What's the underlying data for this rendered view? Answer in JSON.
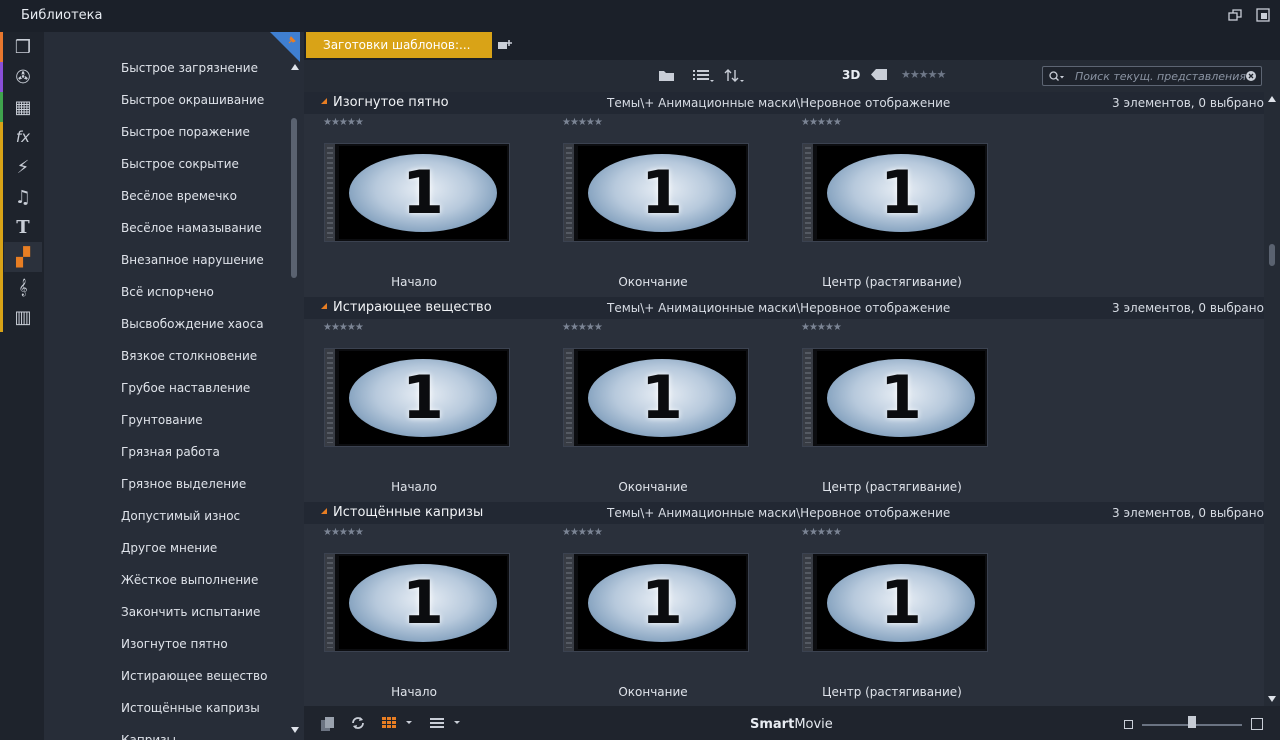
{
  "app": {
    "title": "Библиотека"
  },
  "sidebar_icons": [
    {
      "name": "project-icon",
      "color": "#e8772e",
      "glyph": "❒"
    },
    {
      "name": "video-reel-icon",
      "color": "#8a4fd8",
      "glyph": "✇"
    },
    {
      "name": "photos-icon",
      "color": "#3fa34d",
      "glyph": "▦"
    },
    {
      "name": "fx-icon",
      "color": "#d9a317",
      "glyph": "fx"
    },
    {
      "name": "transition-icon",
      "color": "#d9a317",
      "glyph": "⚡"
    },
    {
      "name": "music-icon",
      "color": "#d9a317",
      "glyph": "♫"
    },
    {
      "name": "title-icon",
      "color": "#d9a317",
      "glyph": "T"
    },
    {
      "name": "montage-icon",
      "color": "#d9a317",
      "glyph": "▞"
    },
    {
      "name": "sound-effect-icon",
      "color": "#d9a317",
      "glyph": "𝄞"
    },
    {
      "name": "scorefitter-icon",
      "color": "#d9a317",
      "glyph": "▥"
    }
  ],
  "categories": [
    "Быстрое загрязнение",
    "Быстрое окрашивание",
    "Быстрое поражение",
    "Быстрое сокрытие",
    "Весёлое времечко",
    "Весёлое намазывание",
    "Внезапное нарушение",
    "Всё испорчено",
    "Высвобождение хаоса",
    "Вязкое столкновение",
    "Грубое наставление",
    "Грунтование",
    "Грязная работа",
    "Грязное выделение",
    "Допустимый износ",
    "Другое мнение",
    "Жёсткое выполнение",
    "Закончить испытание",
    "Изогнутое пятно",
    "Истирающее вещество",
    "Истощённые капризы",
    "Капризы"
  ],
  "tab": {
    "label": "Заготовки шаблонов:..."
  },
  "toolbar": {
    "three_d_label": "3D",
    "search_placeholder": "Поиск текущ. представления",
    "rating": "★★★★★"
  },
  "groups": [
    {
      "title": "Изогнутое пятно",
      "path": "Темы\\+ Анимационные маски\\Неровное отображение",
      "count": "3 элементов, 0 выбрано",
      "items": [
        {
          "label": "Начало",
          "number": "1",
          "stars": "★★★★★"
        },
        {
          "label": "Окончание",
          "number": "1",
          "stars": "★★★★★"
        },
        {
          "label": "Центр (растягивание)",
          "number": "1",
          "stars": "★★★★★"
        }
      ]
    },
    {
      "title": "Истирающее вещество",
      "path": "Темы\\+ Анимационные маски\\Неровное отображение",
      "count": "3 элементов, 0 выбрано",
      "items": [
        {
          "label": "Начало",
          "number": "1",
          "stars": "★★★★★"
        },
        {
          "label": "Окончание",
          "number": "1",
          "stars": "★★★★★"
        },
        {
          "label": "Центр (растягивание)",
          "number": "1",
          "stars": "★★★★★"
        }
      ]
    },
    {
      "title": "Истощённые капризы",
      "path": "Темы\\+ Анимационные маски\\Неровное отображение",
      "count": "3 элементов, 0 выбрано",
      "items": [
        {
          "label": "Начало",
          "number": "1",
          "stars": "★★★★★"
        },
        {
          "label": "Окончание",
          "number": "1",
          "stars": "★★★★★"
        },
        {
          "label": "Центр (растягивание)",
          "number": "1",
          "stars": "★★★★★"
        }
      ]
    }
  ],
  "bottom": {
    "brand_bold": "Smart",
    "brand_rest": "Movie"
  },
  "colors": {
    "accent_tab": "#d9a317",
    "accent_orange": "#e87e23"
  }
}
